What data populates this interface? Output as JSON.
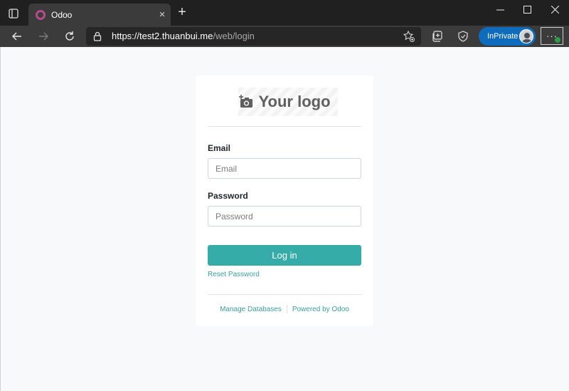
{
  "browser": {
    "tab": {
      "title": "Odoo",
      "close_glyph": "×"
    },
    "new_tab_glyph": "+",
    "window_controls": {
      "minimize": "—",
      "maximize": "☐",
      "close": "✕"
    },
    "address": {
      "host": "https://test2.thuanbui.me",
      "path": "/web/login"
    },
    "inprivate_label": "InPrivate",
    "menu_glyph": "···",
    "accent_color": "#0f6cbd",
    "icons": [
      "tab-actions-icon",
      "odoo-favicon",
      "back-icon",
      "forward-icon",
      "reload-icon",
      "lock-icon",
      "add-favorite-icon",
      "collections-icon",
      "browser-essentials-icon",
      "avatar",
      "more-menu-icon"
    ]
  },
  "login": {
    "logo_text": "Your logo",
    "email": {
      "label": "Email",
      "placeholder": "Email"
    },
    "password": {
      "label": "Password",
      "placeholder": "Password"
    },
    "submit_label": "Log in",
    "reset_password": "Reset Password",
    "footer": {
      "manage_databases": "Manage Databases",
      "powered_by": "Powered by Odoo"
    },
    "button_color": "#35aca8",
    "link_color": "#3a9e9a"
  }
}
